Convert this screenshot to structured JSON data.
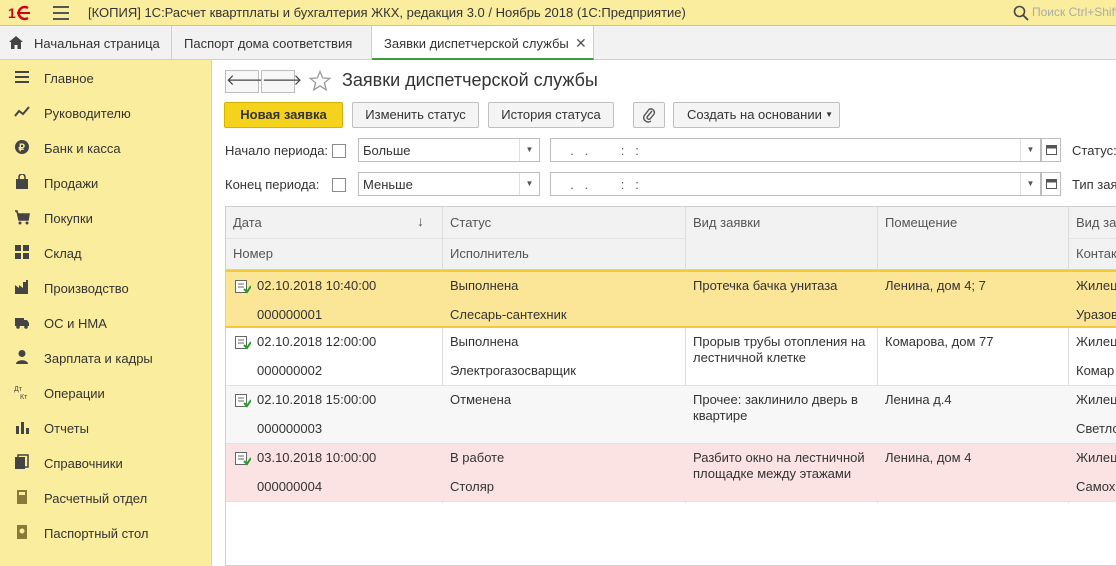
{
  "app": {
    "title": "[КОПИЯ] 1С:Расчет квартплаты и бухгалтерия ЖКХ, редакция 3.0 / Ноябрь 2018  (1С:Предприятие)",
    "search_placeholder": "Поиск Ctrl+Shift+F"
  },
  "tabs": [
    {
      "label": "Начальная страница",
      "icon": "home-icon"
    },
    {
      "label": "Паспорт дома соответствия"
    },
    {
      "label": "Заявки диспетчерской службы",
      "active": true,
      "close": "✕"
    }
  ],
  "sidebar": {
    "items": [
      {
        "label": "Главное",
        "icon": "menu-icon"
      },
      {
        "label": "Руководителю",
        "icon": "trend-icon"
      },
      {
        "label": "Банк и касса",
        "icon": "coin-icon"
      },
      {
        "label": "Продажи",
        "icon": "bag-icon"
      },
      {
        "label": "Покупки",
        "icon": "cart-icon"
      },
      {
        "label": "Склад",
        "icon": "grid-icon"
      },
      {
        "label": "Производство",
        "icon": "factory-icon"
      },
      {
        "label": "ОС и НМА",
        "icon": "truck-icon"
      },
      {
        "label": "Зарплата и кадры",
        "icon": "person-icon"
      },
      {
        "label": "Операции",
        "icon": "dtkt-icon"
      },
      {
        "label": "Отчеты",
        "icon": "bars-icon"
      },
      {
        "label": "Справочники",
        "icon": "books-icon"
      },
      {
        "label": "Расчетный отдел",
        "icon": "calc-icon"
      },
      {
        "label": "Паспортный стол",
        "icon": "passport-icon"
      }
    ]
  },
  "form": {
    "title": "Заявки диспетчерской службы",
    "nav_back": "🡐",
    "nav_forward": "🡒",
    "buttons": {
      "new": "Новая заявка",
      "change_status": "Изменить статус",
      "status_history": "История статуса",
      "create_based": "Создать на основании"
    },
    "filters": {
      "start_label": "Начало периода:",
      "start_op": "Больше",
      "start_value": "  .   .         :   :",
      "end_label": "Конец периода:",
      "end_op": "Меньше",
      "end_value": "  .   .         :   :",
      "status_label": "Статус:",
      "type_label": "Тип зая"
    }
  },
  "table": {
    "headers": {
      "date": "Дата",
      "number": "Номер",
      "status": "Статус",
      "executor": "Исполнитель",
      "type": "Вид заявки",
      "room": "Помещение",
      "vid": "Вид за",
      "contact": "Контак"
    },
    "sort_arrow": "↓",
    "rows": [
      {
        "date": "02.10.2018 10:40:00",
        "number": "000000001",
        "status": "Выполнена",
        "executor": "Слесарь-сантехник",
        "type": "Протечка бачка унитаза",
        "room": "Ленина, дом 4; 7",
        "vid": "Жилец",
        "contact": "Уразов"
      },
      {
        "date": "02.10.2018 12:00:00",
        "number": "000000002",
        "status": "Выполнена",
        "executor": "Электрогазосварщик",
        "type": "Прорыв трубы отопления на лестничной клетке",
        "room": "Комарова, дом 77",
        "vid": "Жилец",
        "contact": "Комар"
      },
      {
        "date": "02.10.2018 15:00:00",
        "number": "000000003",
        "status": "Отменена",
        "executor": "",
        "type": "Прочее: заклинило дверь в квартире",
        "room": "Ленина д.4",
        "vid": "Жилец",
        "contact": "Светло"
      },
      {
        "date": "03.10.2018 10:00:00",
        "number": "000000004",
        "status": "В работе",
        "executor": "Столяр",
        "type": "Разбито окно на лестничной площадке между этажами",
        "room": "Ленина, дом 4",
        "vid": "Жилец",
        "contact": "Самох"
      }
    ]
  },
  "colors": {
    "accent_yellow": "#fbed9e",
    "primary_button": "#f5d21c",
    "selected_row": "#fbe597",
    "inwork_row": "#fbe3e3",
    "active_tab_line": "#3a9c3a"
  }
}
